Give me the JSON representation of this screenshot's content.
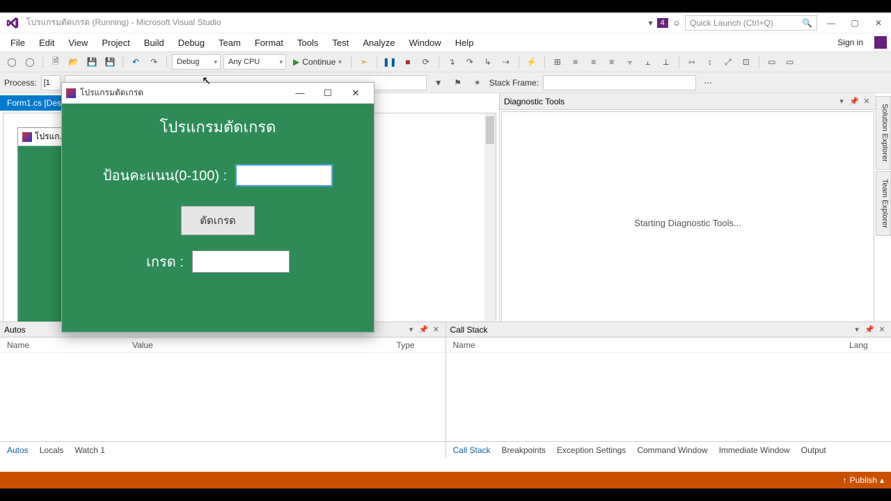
{
  "window": {
    "title": "โปรแกรมตัดเกรด (Running) - Microsoft Visual Studio",
    "notif_count": "4",
    "quick_launch_placeholder": "Quick Launch (Ctrl+Q)",
    "signin": "Sign in"
  },
  "menu": [
    "File",
    "Edit",
    "View",
    "Project",
    "Build",
    "Debug",
    "Team",
    "Format",
    "Tools",
    "Test",
    "Analyze",
    "Window",
    "Help"
  ],
  "toolbar": {
    "config": "Debug",
    "platform": "Any CPU",
    "continue": "Continue"
  },
  "toolbar2": {
    "process_label": "Process:",
    "process_value": "[1",
    "stack_frame_label": "Stack Frame:"
  },
  "doc_tab": "Form1.cs [Des",
  "design_form_title": "โปรแก...",
  "diag": {
    "title": "Diagnostic Tools",
    "status": "Starting Diagnostic Tools..."
  },
  "side_tabs": [
    "Solution Explorer",
    "Team Explorer"
  ],
  "autos": {
    "title": "Autos",
    "cols": {
      "name": "Name",
      "value": "Value",
      "type": "Type"
    },
    "tabs": [
      "Autos",
      "Locals",
      "Watch 1"
    ]
  },
  "callstack": {
    "title": "Call Stack",
    "cols": {
      "name": "Name",
      "lang": "Lang"
    },
    "tabs": [
      "Call Stack",
      "Breakpoints",
      "Exception Settings",
      "Command Window",
      "Immediate Window",
      "Output"
    ]
  },
  "status": {
    "publish": "Publish"
  },
  "app": {
    "title": "โปรแกรมตัดเกรด",
    "heading": "โปรแกรมตัดเกรด",
    "score_label": "ป้อนคะแนน(0-100) :",
    "score_value": "",
    "button": "ตัดเกรด",
    "grade_label": "เกรด :",
    "grade_value": ""
  }
}
